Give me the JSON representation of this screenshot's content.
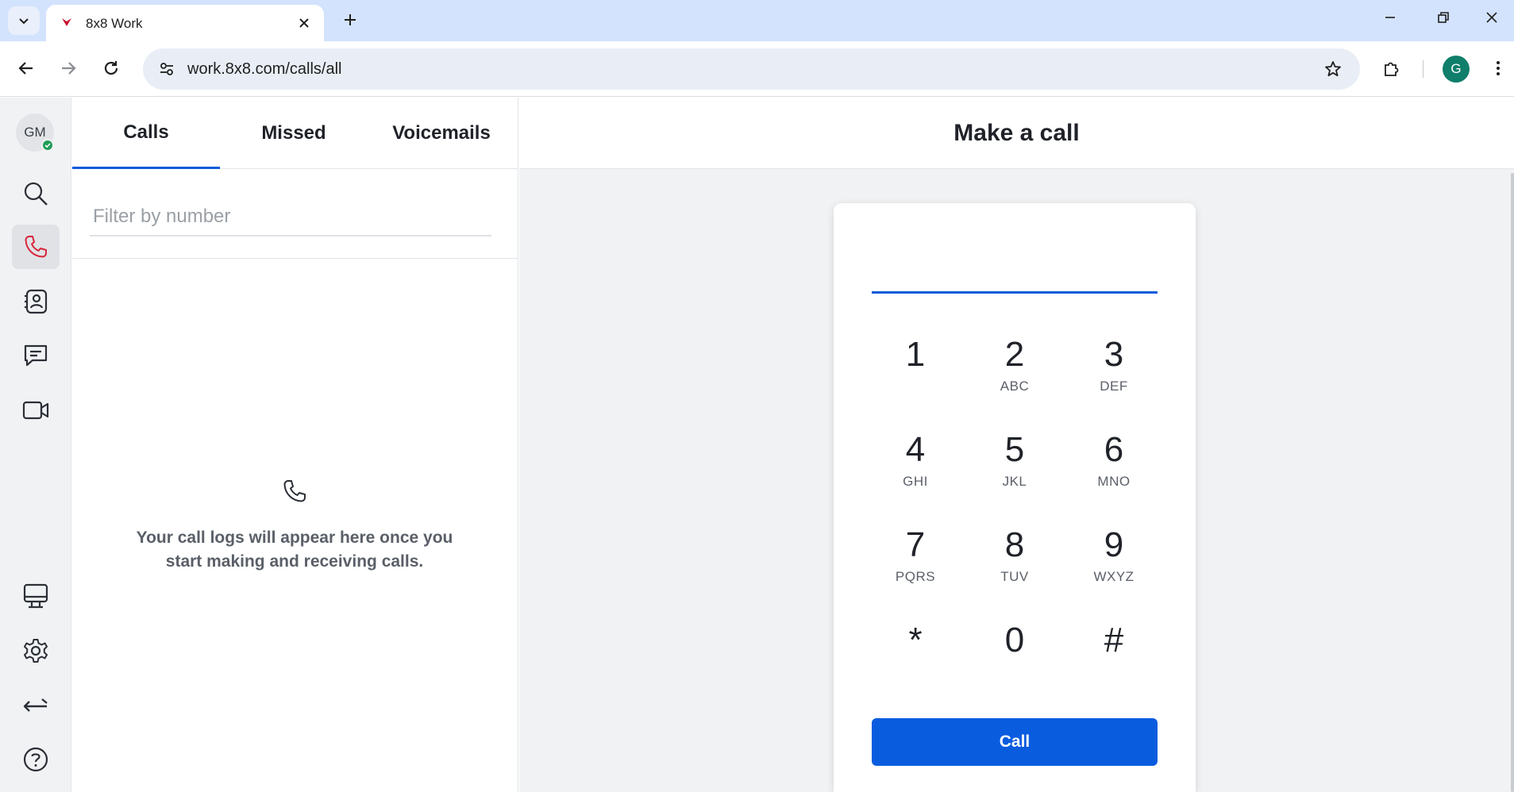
{
  "browser": {
    "tab_title": "8x8 Work",
    "url": "work.8x8.com/calls/all",
    "profile_initial": "G"
  },
  "rail": {
    "user_initials": "GM",
    "presence": "available",
    "items": [
      "search",
      "calls",
      "contacts",
      "messages",
      "meetings",
      "desktop-app",
      "settings",
      "switch",
      "help"
    ],
    "active_item": "calls"
  },
  "calls_panel": {
    "tabs": [
      "Calls",
      "Missed",
      "Voicemails"
    ],
    "active_tab": "Calls",
    "filter_placeholder": "Filter by number",
    "empty_message": "Your call logs will appear here once you start making and receiving calls."
  },
  "dialer": {
    "title": "Make a call",
    "number_value": "",
    "keys": [
      {
        "digit": "1",
        "letters": ""
      },
      {
        "digit": "2",
        "letters": "ABC"
      },
      {
        "digit": "3",
        "letters": "DEF"
      },
      {
        "digit": "4",
        "letters": "GHI"
      },
      {
        "digit": "5",
        "letters": "JKL"
      },
      {
        "digit": "6",
        "letters": "MNO"
      },
      {
        "digit": "7",
        "letters": "PQRS"
      },
      {
        "digit": "8",
        "letters": "TUV"
      },
      {
        "digit": "9",
        "letters": "WXYZ"
      },
      {
        "digit": "*",
        "letters": ""
      },
      {
        "digit": "0",
        "letters": ""
      },
      {
        "digit": "#",
        "letters": ""
      }
    ],
    "call_label": "Call"
  },
  "colors": {
    "accent": "#0a5cd9",
    "call_button": "#0a5cdf",
    "active_icon": "#d9263a",
    "presence": "#1f9d55"
  }
}
